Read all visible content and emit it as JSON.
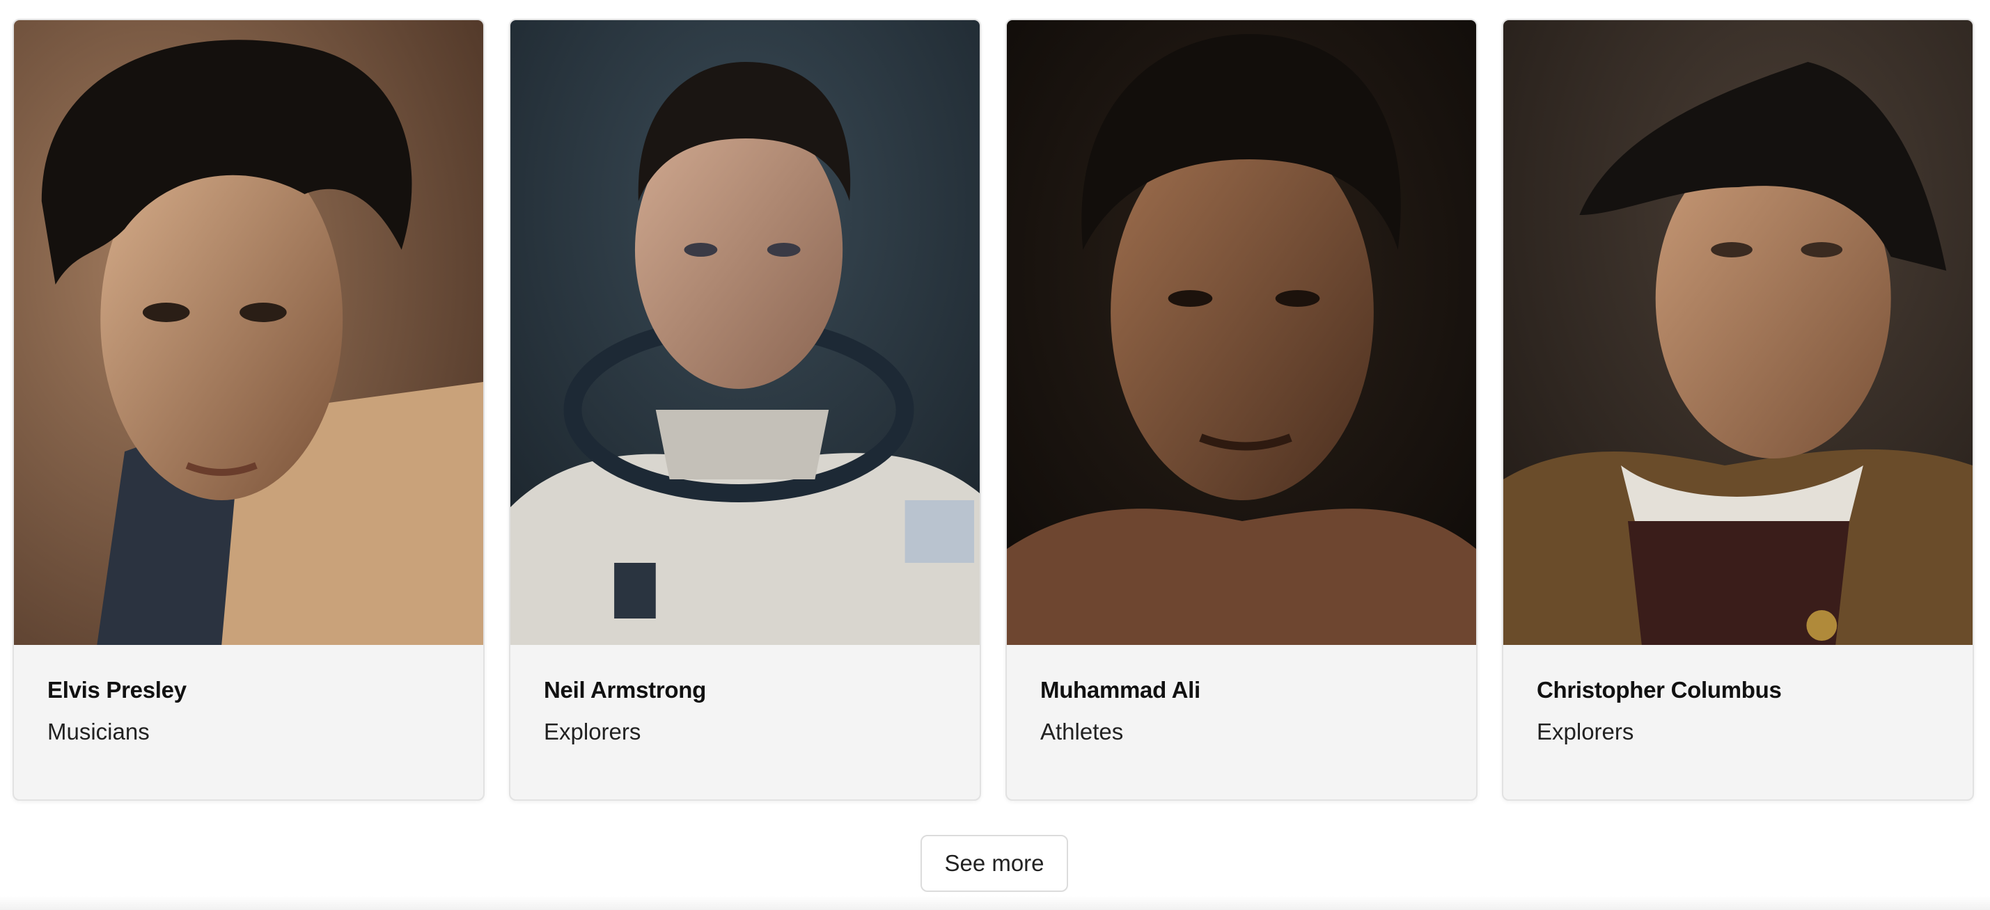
{
  "cards": [
    {
      "name": "Elvis Presley",
      "category": "Musicians",
      "portrait": "portrait-image"
    },
    {
      "name": "Neil Armstrong",
      "category": "Explorers",
      "portrait": "portrait-image"
    },
    {
      "name": "Muhammad Ali",
      "category": "Athletes",
      "portrait": "portrait-image"
    },
    {
      "name": "Christopher Columbus",
      "category": "Explorers",
      "portrait": "portrait-image"
    }
  ],
  "see_more_label": "See more",
  "colors": {
    "card_background": "#f4f4f4",
    "card_border": "#e2e2e2",
    "text_primary": "#111111"
  }
}
